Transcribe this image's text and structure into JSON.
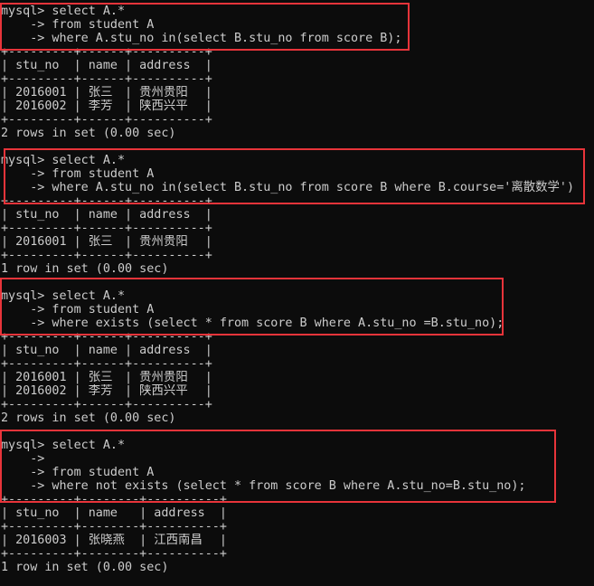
{
  "terminal": {
    "background": "#0c0c0c",
    "text_color": "#cccccc",
    "highlight_color": "#e8343a",
    "blocks": [
      {
        "query": [
          "mysql> select A.*",
          "    -> from student A",
          "    -> where A.stu_no in(select B.stu_no from score B);"
        ],
        "columns": [
          "stu_no",
          "name",
          "address"
        ],
        "rows": [
          [
            "2016001",
            "张三",
            "贵州贵阳"
          ],
          [
            "2016002",
            "李芳",
            "陕西兴平"
          ]
        ],
        "status": "2 rows in set (0.00 sec)",
        "highlighted": true
      },
      {
        "query": [
          "mysql> select A.*",
          "    -> from student A",
          "    -> where A.stu_no in(select B.stu_no from score B where B.course='离散数学')"
        ],
        "columns": [
          "stu_no",
          "name",
          "address"
        ],
        "rows": [
          [
            "2016001",
            "张三",
            "贵州贵阳"
          ]
        ],
        "status": "1 row in set (0.00 sec)",
        "highlighted": true
      },
      {
        "query": [
          "mysql> select A.*",
          "    -> from student A",
          "    -> where exists (select * from score B where A.stu_no =B.stu_no);"
        ],
        "columns": [
          "stu_no",
          "name",
          "address"
        ],
        "rows": [
          [
            "2016001",
            "张三",
            "贵州贵阳"
          ],
          [
            "2016002",
            "李芳",
            "陕西兴平"
          ]
        ],
        "status": "2 rows in set (0.00 sec)",
        "highlighted": true
      },
      {
        "query": [
          "mysql> select A.*",
          "    ->",
          "    -> from student A",
          "    -> where not exists (select * from score B where A.stu_no=B.stu_no);"
        ],
        "columns": [
          "stu_no",
          "name",
          "address"
        ],
        "rows": [
          [
            "2016003",
            "张晓燕",
            "江西南昌"
          ]
        ],
        "status": "1 row in set (0.00 sec)",
        "highlighted": true
      }
    ]
  }
}
